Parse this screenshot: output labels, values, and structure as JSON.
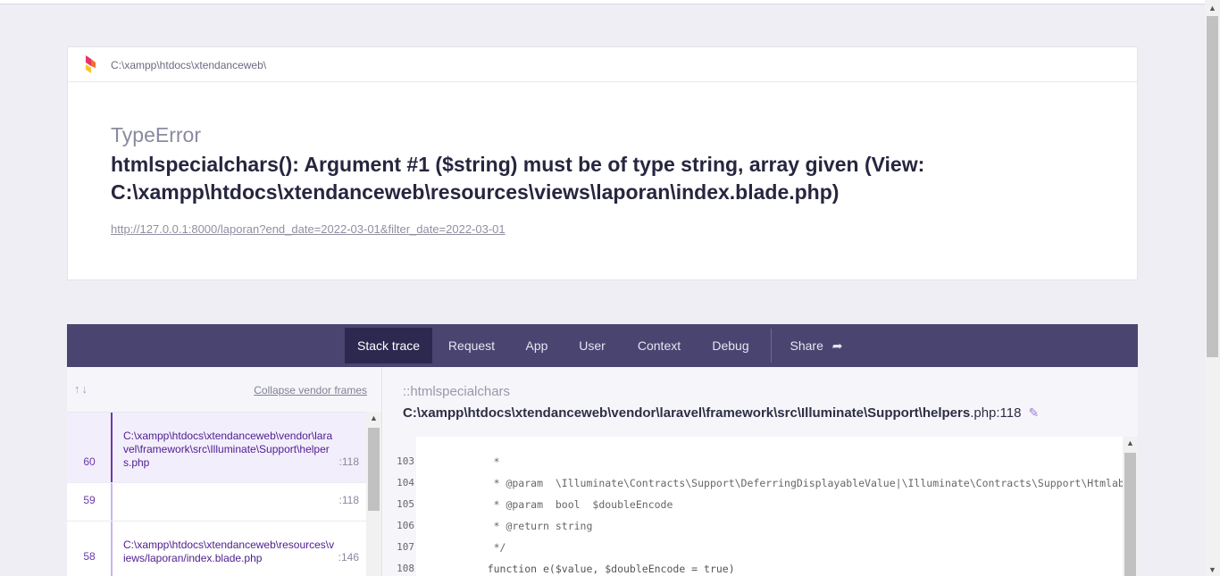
{
  "header": {
    "root_path": "C:\\xampp\\htdocs\\xtendanceweb\\"
  },
  "exception": {
    "class": "TypeError",
    "message": "htmlspecialchars(): Argument #1 ($string) must be of type string, array given (View: C:\\xampp\\htdocs\\xtendanceweb\\resources\\views\\laporan\\index.blade.php)",
    "url": "http://127.0.0.1:8000/laporan?end_date=2022-03-01&filter_date=2022-03-01"
  },
  "tabs": [
    {
      "label": "Stack trace",
      "active": true
    },
    {
      "label": "Request"
    },
    {
      "label": "App"
    },
    {
      "label": "User"
    },
    {
      "label": "Context"
    },
    {
      "label": "Debug"
    },
    {
      "label": "Share",
      "icon": "share-icon"
    }
  ],
  "stack": {
    "collapse_label": "Collapse vendor frames",
    "frames": [
      {
        "number": "60",
        "file": "C:\\xampp\\htdocs\\xtendanceweb\\vendor\\laravel\\framework\\src\\Illuminate\\Support\\helpers.php",
        "line": ":118",
        "selected": true
      },
      {
        "number": "59",
        "file": "",
        "line": ":118"
      },
      {
        "number": "58",
        "file": "C:\\xampp\\htdocs\\xtendanceweb\\resources\\views/laporan/index.blade.php",
        "line": ":146"
      }
    ]
  },
  "code_view": {
    "function": "::htmlspecialchars",
    "file_path": "C:\\xampp\\htdocs\\xtendanceweb\\vendor\\laravel\\framework\\src\\Illuminate\\Support\\helpers",
    "file_ext_line": ".php:118",
    "lines": [
      {
        "n": "103",
        "code": "     *"
      },
      {
        "n": "104",
        "code": "     * @param  \\Illuminate\\Contracts\\Support\\DeferringDisplayableValue|\\Illuminate\\Contracts\\Support\\Htmlable|"
      },
      {
        "n": "105",
        "code": "     * @param  bool  $doubleEncode"
      },
      {
        "n": "106",
        "code": "     * @return string"
      },
      {
        "n": "107",
        "code": "     */"
      },
      {
        "n": "108",
        "code": "    function e($value, $doubleEncode = true)"
      }
    ]
  },
  "colors": {
    "tabbar": "#4a4570",
    "tab_active": "#2c2850",
    "accent": "#6a3aa8"
  }
}
